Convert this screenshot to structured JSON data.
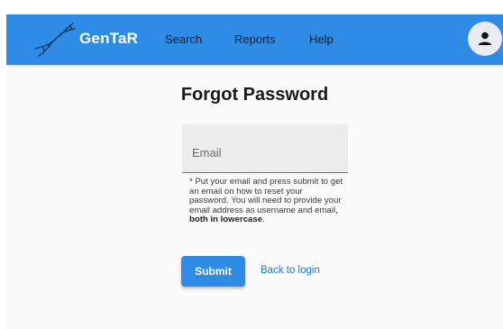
{
  "header": {
    "brand": "GenTaR",
    "nav": [
      {
        "label": "Search"
      },
      {
        "label": "Reports"
      },
      {
        "label": "Help"
      }
    ],
    "logo_icon": "dna-helix-icon",
    "account_icon": "person-icon"
  },
  "page": {
    "title": "Forgot Password",
    "email": {
      "placeholder": "Email",
      "value": ""
    },
    "hint": {
      "text": "* Put your email and press submit to get an email on how to reset your password. You will need to provide your email address as username and email, ",
      "bold": "both in lowercase",
      "end": "."
    },
    "submit_label": "Submit",
    "back_label": "Back to login"
  },
  "colors": {
    "header_bg": "#2f8ce6",
    "page_bg": "#fafafa",
    "link": "#1f78d1"
  }
}
